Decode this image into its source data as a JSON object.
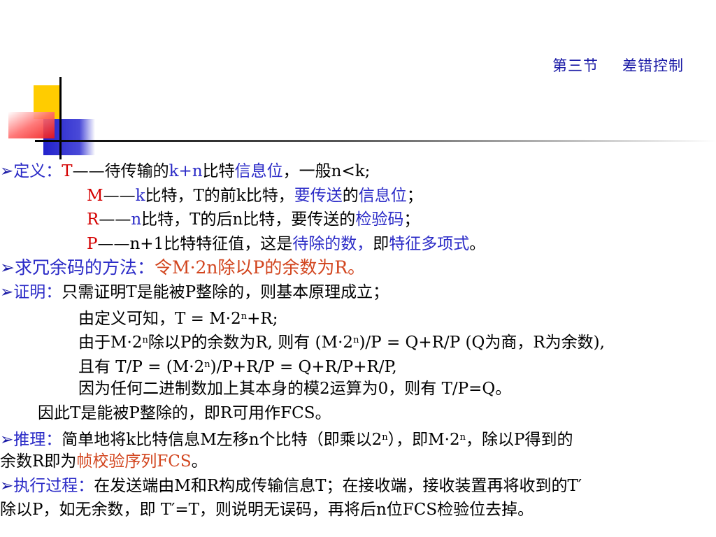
{
  "header": {
    "section": "第三节",
    "title": "差错控制"
  },
  "def": {
    "label": "定义：",
    "t": {
      "sym": "T",
      "dash": "——",
      "a": "待传输的",
      "kn": "k+n",
      "b": "比特",
      "c": "信息位",
      "d": "，一般n<k;"
    },
    "m": {
      "sym": "M",
      "dash": "——",
      "k": "k",
      "a": "比特，T的前k比特，",
      "b": "要传送",
      "c": "的",
      "d": "信息位",
      "e": "；"
    },
    "r": {
      "sym": "R",
      "dash": "——",
      "n": "n",
      "a": "比特，T的后n比特，要传送的",
      "b": "检验码",
      "c": "；"
    },
    "p": {
      "sym": "P",
      "dash": "——",
      "a": "n+1比特特征值，这是",
      "b": "待除的数",
      "c": "，",
      "d": "即",
      "e": "特征多项式",
      "f": "。"
    }
  },
  "method": {
    "label": "求冗余码的方法：",
    "text": "令M·2n除以P的余数为R。"
  },
  "proof": {
    "label": "证明：",
    "l1": "只需证明T是能被P整除的，则基本原理成立；",
    "l2a": "由定义可知，T = M·2",
    "l2b": "+R;",
    "l3a": "由于M·2",
    "l3b": "除以P的余数为R, 则有 (M·2",
    "l3c": ")/P = Q+R/P (Q为商，R为余数),",
    "l4a": "且有  T/P = (M·2",
    "l4b": ")/P+R/P = Q+R/P+R/P,",
    "l5": "因为任何二进制数加上其本身的模2运算为0，则有 T/P=Q。",
    "l6": "因此T是能被P整除的，即R可用作FCS。",
    "sup": "n"
  },
  "infer": {
    "label": "推理：",
    "l1a": "简单地将k比特信息M左移n个比特（即乘以2",
    "l1b": "），即M·2",
    "l1c": "，除以P得到的",
    "l2a": "余数R即为",
    "l2b": "帧校验序列FCS",
    "l2c": "。"
  },
  "exec": {
    "label": "执行过程：",
    "l1": "在发送端由M和R构成传输信息T；在接收端，接收装置再将收到的T′",
    "l2": "除以P，如无余数，即 T′=T，则说明无误码，再将后n位FCS检验位去掉。"
  },
  "bullet": "➢"
}
